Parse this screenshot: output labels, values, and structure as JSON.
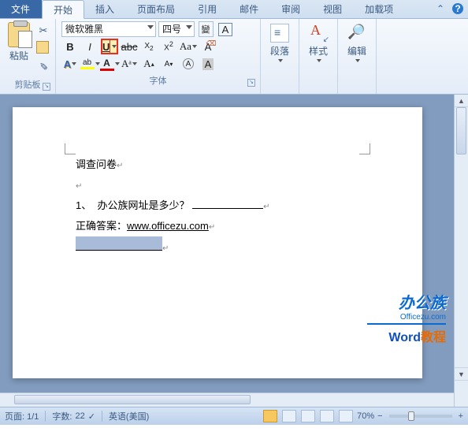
{
  "tabs": {
    "file": "文件",
    "home": "开始",
    "insert": "插入",
    "layout": "页面布局",
    "references": "引用",
    "mail": "邮件",
    "review": "审阅",
    "view": "视图",
    "addins": "加载项"
  },
  "ribbon": {
    "clipboard": {
      "label": "剪贴板",
      "paste": "粘贴"
    },
    "font": {
      "label": "字体",
      "name": "微软雅黑",
      "size": "四号",
      "wen": "變",
      "a_box": "A"
    },
    "paragraph": {
      "label": "段落"
    },
    "styles": {
      "label": "样式"
    },
    "editing": {
      "label": "编辑"
    }
  },
  "document": {
    "title": "调查问卷",
    "q1_num": "1、",
    "q1_text": "办公族网址是多少？",
    "ans_label": "正确答案：",
    "ans_value": "www.officezu.com"
  },
  "watermark": {
    "line1": "办公族",
    "line2": "Officezu.com",
    "line3_a": "Word",
    "line3_b": "教程"
  },
  "status": {
    "page": "页面: 1/1",
    "words_label": "字数:",
    "words": "22",
    "lang": "英语(美国)",
    "zoom": "70%",
    "minus": "−",
    "plus": "+"
  }
}
